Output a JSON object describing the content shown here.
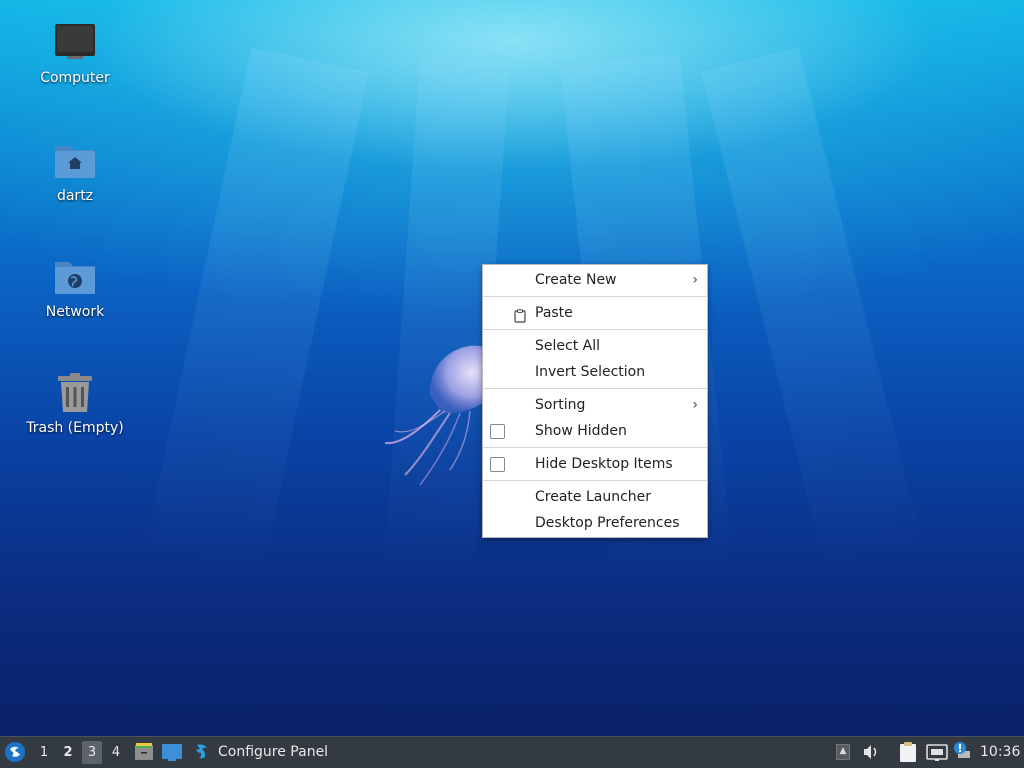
{
  "desktop": {
    "icons": [
      {
        "name": "computer",
        "label": "Computer"
      },
      {
        "name": "home-folder",
        "label": "dartz"
      },
      {
        "name": "network",
        "label": "Network"
      },
      {
        "name": "trash",
        "label": "Trash (Empty)"
      }
    ]
  },
  "context_menu": {
    "items": {
      "create_new": "Create New",
      "paste": "Paste",
      "select_all": "Select All",
      "invert_selection": "Invert Selection",
      "sorting": "Sorting",
      "show_hidden": "Show Hidden",
      "hide_desktop_items": "Hide Desktop Items",
      "create_launcher": "Create Launcher",
      "desktop_preferences": "Desktop Preferences"
    },
    "submenu_arrow": "›"
  },
  "taskbar": {
    "workspaces": [
      "1",
      "2",
      "3",
      "4"
    ],
    "active_workspace": "3",
    "task_label": "Configure Panel",
    "clock": "10:36"
  },
  "colors": {
    "taskbar_bg": "#333a42",
    "menu_bg": "#ffffff",
    "folder_blue": "#5b9bd8"
  }
}
